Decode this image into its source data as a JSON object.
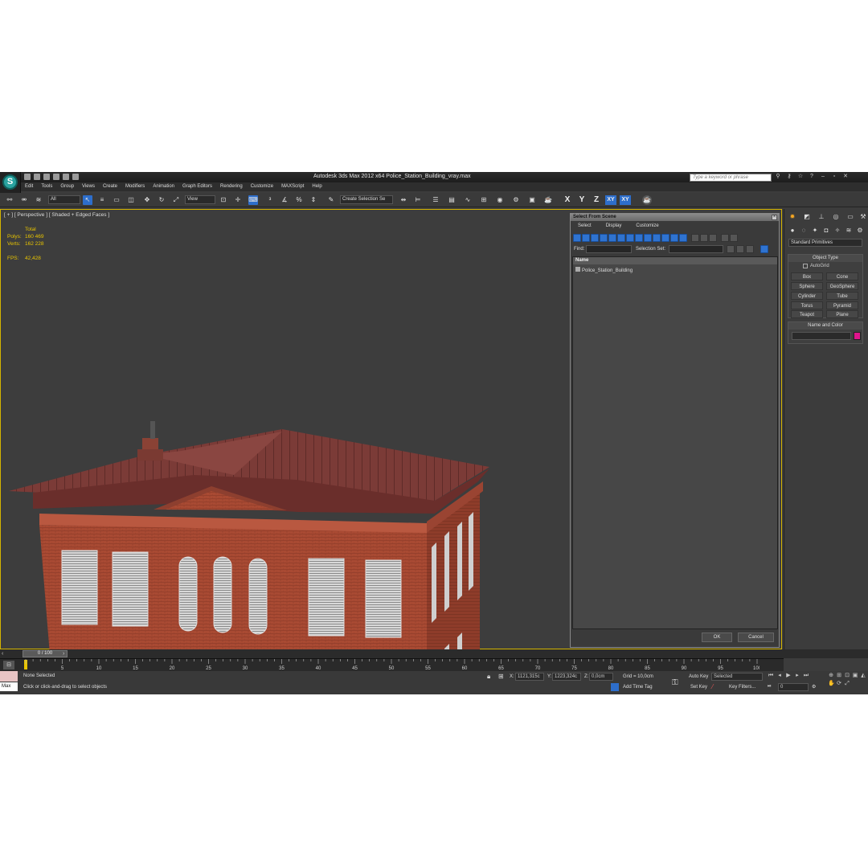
{
  "title": "Autodesk 3ds Max  2012 x64     Police_Station_Building_vray.max",
  "search_placeholder": "Type a keyword or phrase",
  "app_logo": "S",
  "menu": [
    "Edit",
    "Tools",
    "Group",
    "Views",
    "Create",
    "Modifiers",
    "Animation",
    "Graph Editors",
    "Rendering",
    "Customize",
    "MAXScript",
    "Help"
  ],
  "toolbar": {
    "selection_filter": "All",
    "ref_coord": "View",
    "named_selection": "Create Selection Se",
    "axis": [
      "X",
      "Y",
      "Z",
      "XY",
      "XY"
    ]
  },
  "viewport": {
    "label": "[ + ] [ Perspective ] [ Shaded + Edged Faces ]",
    "stats": {
      "total_label": "Total",
      "polys_label": "Polys:",
      "polys": "160 469",
      "verts_label": "Verts:",
      "verts": "162 228",
      "fps_label": "FPS:",
      "fps": "42,428"
    }
  },
  "dialog": {
    "title": "Select From Scene",
    "menu": [
      "Select",
      "Display",
      "Customize"
    ],
    "find_label": "Find:",
    "selection_set_label": "Selection Set:",
    "column_header": "Name",
    "items": [
      "Police_Station_Building"
    ],
    "ok": "OK",
    "cancel": "Cancel"
  },
  "command_panel": {
    "category": "Standard Primitives",
    "object_type_header": "Object Type",
    "autogrid": "AutoGrid",
    "primitives": [
      "Box",
      "Cone",
      "Sphere",
      "GeoSphere",
      "Cylinder",
      "Tube",
      "Torus",
      "Pyramid",
      "Teapot",
      "Plane"
    ],
    "name_color_header": "Name and Color",
    "object_color": "#e0148c"
  },
  "timeline": {
    "frame_counter": "0 / 100",
    "ticks": [
      "0",
      "5",
      "10",
      "15",
      "20",
      "25",
      "30",
      "35",
      "40",
      "45",
      "50",
      "55",
      "60",
      "65",
      "70",
      "75",
      "80",
      "85",
      "90",
      "95",
      "100"
    ]
  },
  "status": {
    "maxscript": "Max",
    "selection": "None Selected",
    "prompt": "Click or click-and-drag to select objects",
    "x_label": "X:",
    "x": "1121,315c",
    "y_label": "Y:",
    "y": "1223,324c",
    "z_label": "Z:",
    "z": "0,0cm",
    "grid": "Grid = 10,0cm",
    "add_time_tag": "Add Time Tag",
    "auto_key": "Auto Key",
    "set_key": "Set Key",
    "key_mode": "Selected",
    "key_filters": "Key Filters...",
    "current_frame": "0"
  }
}
